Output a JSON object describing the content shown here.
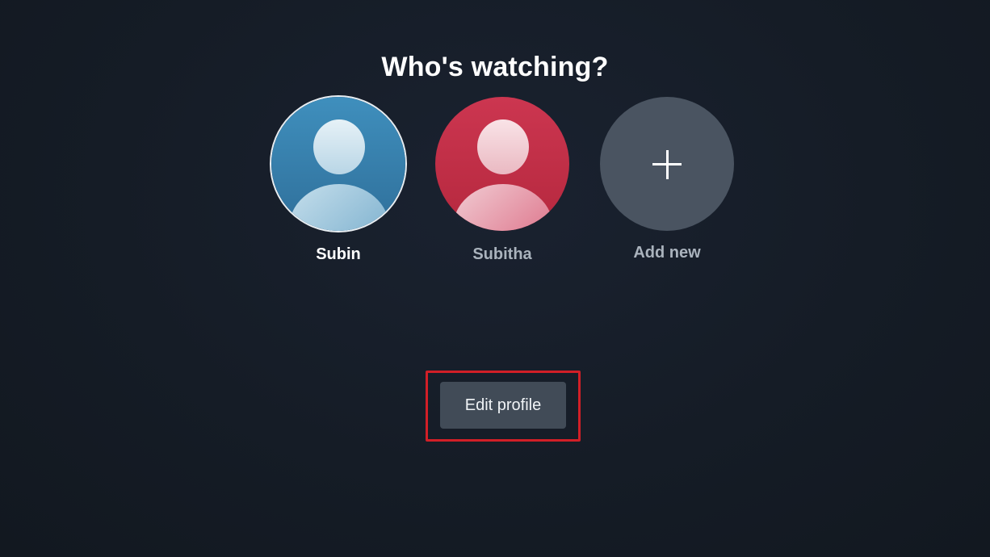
{
  "header": {
    "title": "Who's watching?"
  },
  "profiles": [
    {
      "name": "Subin",
      "color": "#3a86b4",
      "selected": true,
      "icon": "user-avatar-icon"
    },
    {
      "name": "Subitha",
      "color": "#c42f48",
      "selected": false,
      "icon": "user-avatar-icon"
    }
  ],
  "add_profile": {
    "label": "Add new",
    "icon": "plus-icon"
  },
  "actions": {
    "edit_label": "Edit profile"
  },
  "colors": {
    "background": "#161d27",
    "highlight_border": "#d21f27",
    "button": "#414b57"
  }
}
